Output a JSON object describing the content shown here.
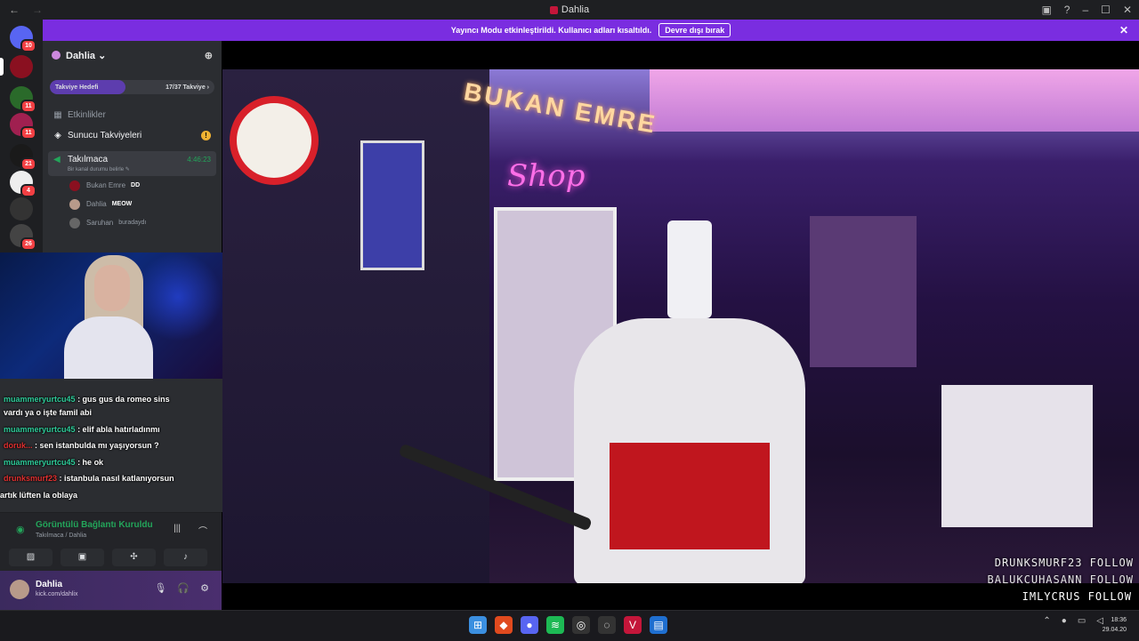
{
  "window": {
    "title": "Dahlia",
    "back": "←",
    "forward": "→"
  },
  "banner": {
    "text": "Yayıncı Modu etkinleştirildi. Kullanıcı adları kısaltıldı.",
    "button": "Devre dışı bırak",
    "close": "✕"
  },
  "server": {
    "name": "Dahlia ⌄",
    "boost_label": "Takviye Hedefi",
    "boost_count": "17/37 Takviye ›",
    "boost_progress": 0.46
  },
  "rail": {
    "badges": [
      "10",
      "11",
      "11",
      "21",
      "4",
      "26"
    ]
  },
  "channels": {
    "events": "Etkinlikler",
    "boosts": "Sunucu Takviyeleri",
    "voice_name": "Takılmaca",
    "voice_sub": "Bir kanal durumu belirle ✎",
    "voice_time": "4:46:23"
  },
  "voice_users": [
    {
      "name": "Bukan Emre",
      "tag": "DD"
    },
    {
      "name": "Dahlia",
      "tag": "MEOW"
    },
    {
      "name": "Saruhan",
      "tag": "buradaydı"
    }
  ],
  "chat": [
    {
      "user": "muammeryurtcu45",
      "msg": ": gus gus da romeo sins",
      "cls": "u1"
    },
    {
      "user": "",
      "msg": "vardı ya o işte famil abi",
      "cls": ""
    },
    {
      "user": "muammeryurtcu45",
      "msg": ": elif abla hatırladınmı",
      "cls": "u1"
    },
    {
      "user": "doruk...",
      "msg": ": sen istanbulda mı yaşıyorsun ?",
      "cls": "u2"
    },
    {
      "user": "muammeryurtcu45",
      "msg": ": he ok",
      "cls": "u1"
    },
    {
      "user": "drunksmurf23",
      "msg": ": istanbula nasıl katlanıyorsun",
      "cls": "u2"
    },
    {
      "user": "",
      "msg": "artık lüften la oblaya",
      "cls": ""
    }
  ],
  "voice_bar": {
    "status": "Görüntülü Bağlantı Kuruldu",
    "where": "Takılmaca / Dahlia"
  },
  "user": {
    "name": "Dahlia",
    "status": "kick.com/dahlix"
  },
  "stream": {
    "neon_top": "BUKAN EMRE",
    "neon_sign": "Shop"
  },
  "follows": [
    "DRUNKSMURF23 FOLLOW",
    "BALUKCUHASANN FOLLOW",
    "IMLYCRUS FOLLOW"
  ],
  "clock": {
    "time": "18:36",
    "date": "29.04.20"
  }
}
